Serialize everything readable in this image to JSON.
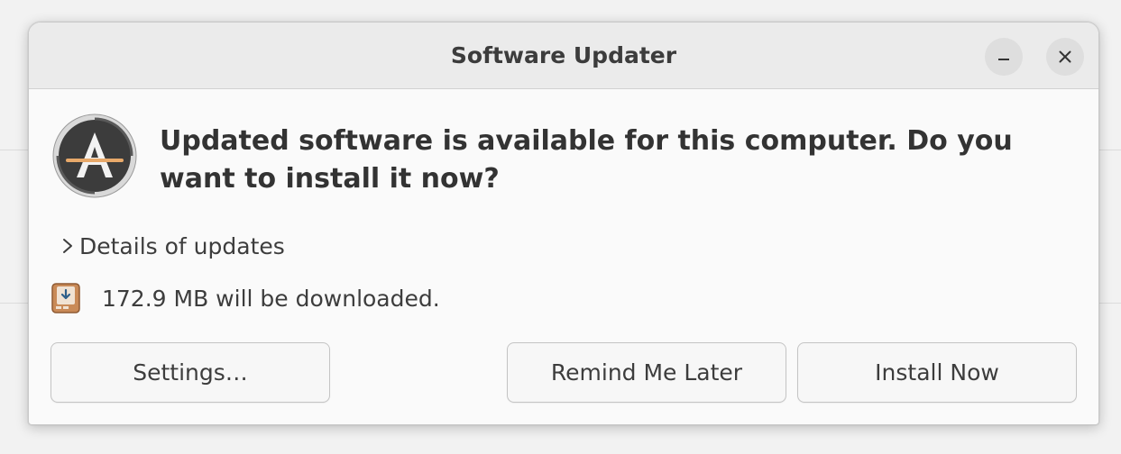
{
  "window": {
    "title": "Software Updater"
  },
  "message": {
    "headline": "Updated software is available for this computer. Do you want to install it now?"
  },
  "details": {
    "label": "Details of updates"
  },
  "download": {
    "text": "172.9 MB will be downloaded."
  },
  "buttons": {
    "settings": "Settings…",
    "remind_later": "Remind Me Later",
    "install_now": "Install Now"
  },
  "icons": {
    "app": "software-updater-icon",
    "expander": "chevron-right-icon",
    "package": "package-download-icon",
    "minimize": "minimize-icon",
    "close": "close-icon"
  }
}
